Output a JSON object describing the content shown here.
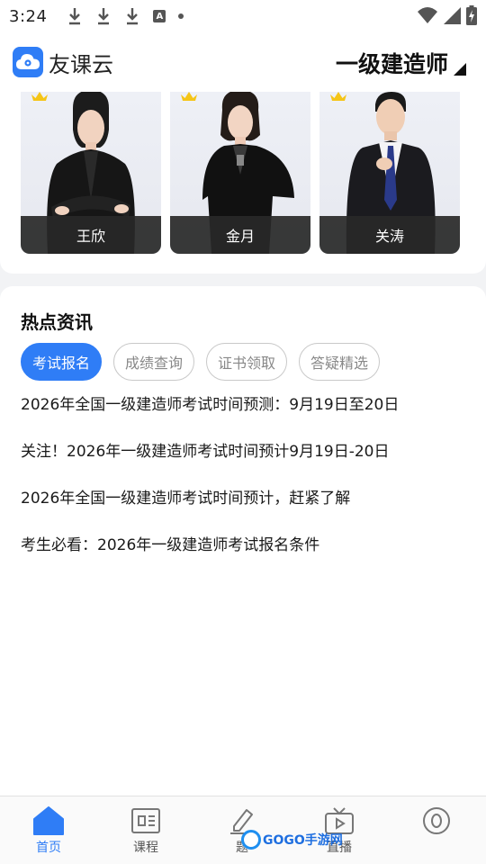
{
  "statusbar": {
    "time": "3:24",
    "icons": [
      "download-icon",
      "download-icon",
      "download-icon",
      "a-icon",
      "dot-icon",
      "wifi-icon",
      "signal-icon",
      "battery-icon"
    ]
  },
  "header": {
    "brand": "友课云",
    "exam_selector": "一级建造师"
  },
  "teachers": [
    {
      "name": "王欣"
    },
    {
      "name": "金月"
    },
    {
      "name": "关涛"
    }
  ],
  "news": {
    "title": "热点资讯",
    "tabs": [
      {
        "label": "考试报名",
        "active": true
      },
      {
        "label": "成绩查询",
        "active": false
      },
      {
        "label": "证书领取",
        "active": false
      },
      {
        "label": "答疑精选",
        "active": false
      }
    ],
    "items": [
      "2026年全国一级建造师考试时间预测：9月19日至20日",
      "关注！2026年一级建造师考试时间预计9月19日-20日",
      "2026年全国一级建造师考试时间预计，赶紧了解",
      "考生必看：2026年一级建造师考试报名条件"
    ]
  },
  "bottomnav": {
    "items": [
      {
        "label": "首页",
        "icon": "home-icon",
        "active": true
      },
      {
        "label": "课程",
        "icon": "course-icon",
        "active": false
      },
      {
        "label": "题",
        "icon": "pen-icon",
        "active": false
      },
      {
        "label": "直播",
        "icon": "live-tv-icon",
        "active": false
      },
      {
        "label": "",
        "icon": "profile-icon",
        "active": false
      }
    ]
  },
  "watermark": "GOGO手游网",
  "colors": {
    "accent": "#2f7df6",
    "dark_label": "#282828"
  }
}
